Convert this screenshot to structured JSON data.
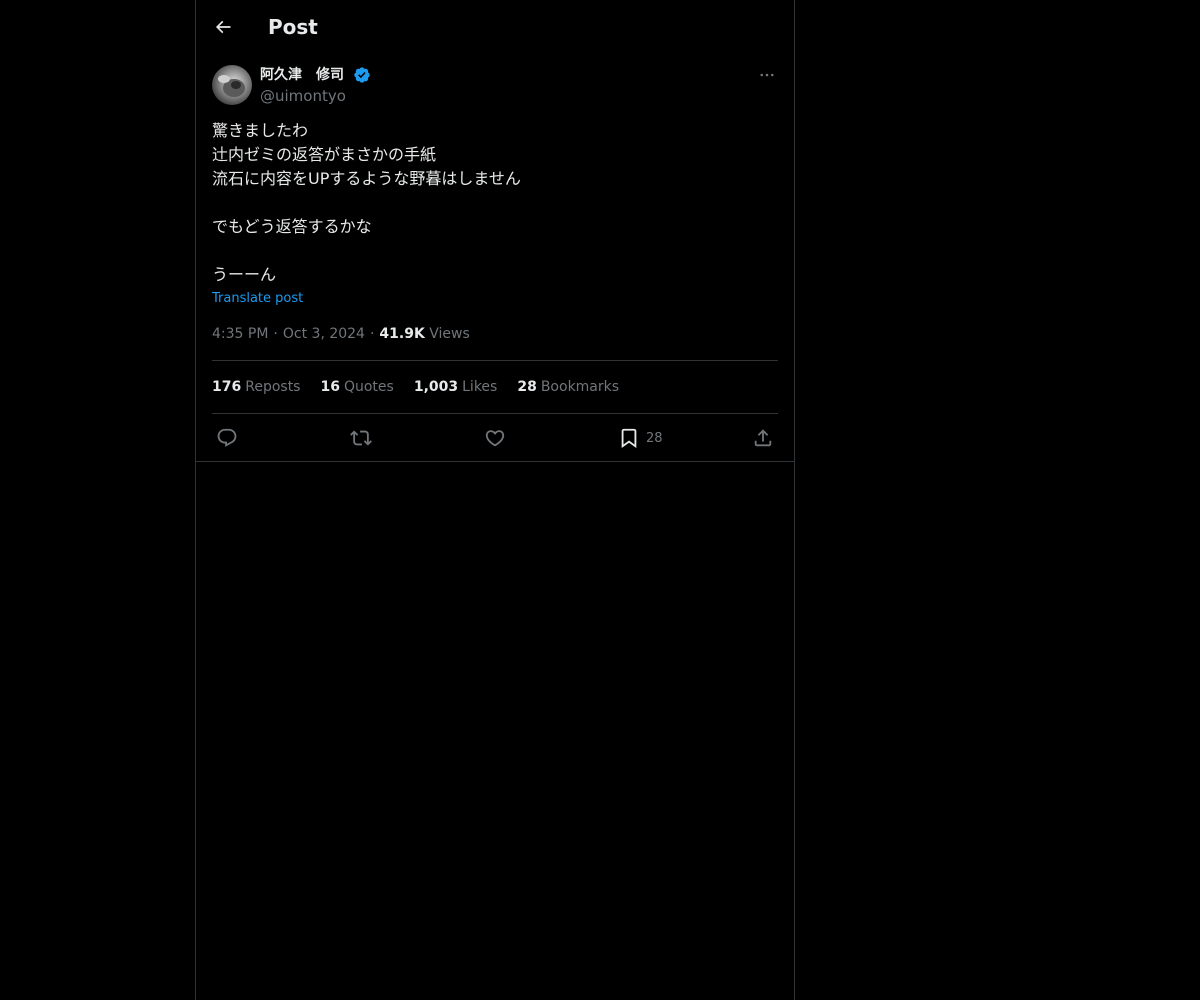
{
  "header": {
    "title": "Post",
    "back_icon": "arrow-left-icon"
  },
  "author": {
    "name": "阿久津　修司",
    "handle": "@uimontyo",
    "verified": true,
    "verified_color": "#1d9bf0"
  },
  "post": {
    "lines": [
      "驚きましたわ",
      "辻内ゼミの返答がまさかの手紙",
      "流石に内容をUPするような野暮はしません",
      "",
      "でもどう返答するかな",
      "",
      "うーーん"
    ],
    "translate_label": "Translate post",
    "time": "4:35 PM",
    "date": "Oct 3, 2024",
    "views_count": "41.9K",
    "views_label": "Views",
    "dot": "·"
  },
  "stats": {
    "reposts": {
      "count": "176",
      "label": "Reposts"
    },
    "quotes": {
      "count": "16",
      "label": "Quotes"
    },
    "likes": {
      "count": "1,003",
      "label": "Likes"
    },
    "bookmarks": {
      "count": "28",
      "label": "Bookmarks"
    }
  },
  "actions": {
    "reply": {
      "icon": "reply-icon"
    },
    "repost": {
      "icon": "repost-icon"
    },
    "like": {
      "icon": "heart-icon"
    },
    "bookmark": {
      "icon": "bookmark-icon",
      "count": "28"
    },
    "share": {
      "icon": "share-icon"
    }
  },
  "colors": {
    "background": "#000000",
    "text": "#e7e9ea",
    "muted": "#71767b",
    "accent": "#1d9bf0",
    "border": "#2f3336"
  }
}
